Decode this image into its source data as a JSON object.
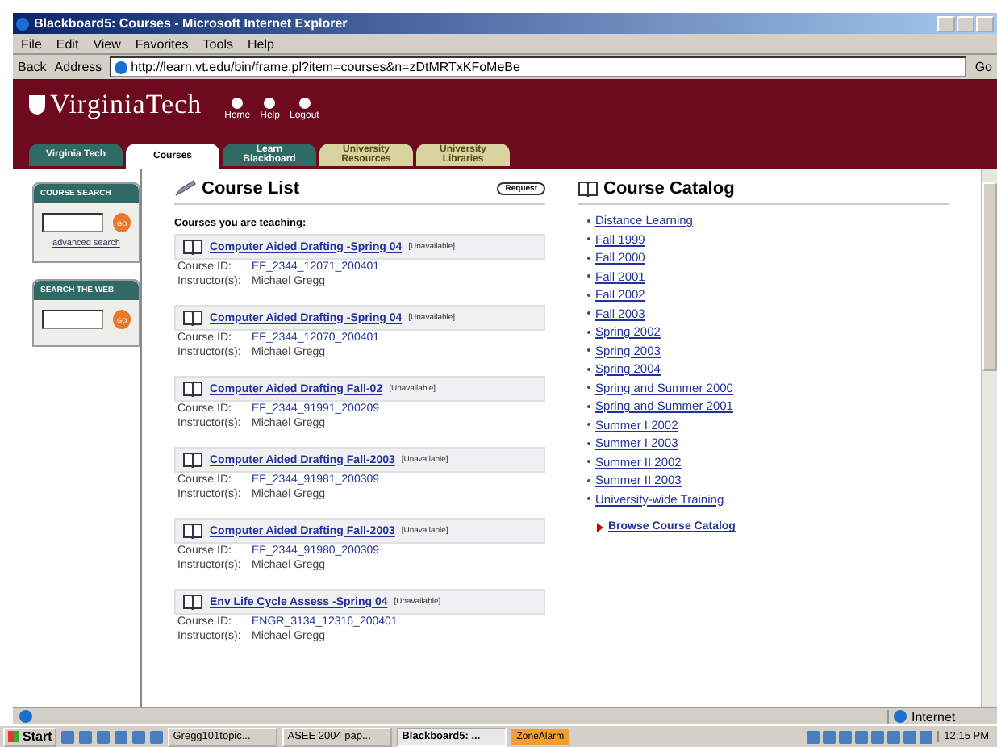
{
  "window": {
    "title": "Blackboard5: Courses - Microsoft Internet Explorer"
  },
  "menu": [
    "File",
    "Edit",
    "View",
    "Favorites",
    "Tools",
    "Help"
  ],
  "toolbar": {
    "back": "Back",
    "address_label": "Address",
    "url": "http://learn.vt.edu/bin/frame.pl?item=courses&n=zDtMRTxKFoMeBe",
    "go": "Go"
  },
  "header": {
    "logo": "VirginiaTech",
    "nav": [
      "Home",
      "Help",
      "Logout"
    ]
  },
  "tabs": [
    {
      "label": "Virginia Tech",
      "selected": false,
      "color": "#2f6b64"
    },
    {
      "label": "Courses",
      "selected": true,
      "color": "#ffffff"
    },
    {
      "label": "Learn Blackboard",
      "selected": false,
      "color": "#2f6b64"
    },
    {
      "label": "University Resources",
      "selected": false,
      "color": "#d8d3a0"
    },
    {
      "label": "University Libraries",
      "selected": false,
      "color": "#d8d3a0"
    }
  ],
  "sidebar": [
    {
      "title": "COURSE SEARCH",
      "button": "GO",
      "link": "advanced search"
    },
    {
      "title": "SEARCH THE WEB",
      "button": "GO"
    }
  ],
  "course_list": {
    "title": "Course List",
    "request": "Request",
    "subtitle": "Courses you are teaching:",
    "courses": [
      {
        "title": "Computer Aided Drafting -Spring 04",
        "status": "[Unavailable]",
        "id_label": "Course ID:",
        "id": "EF_2344_12071_200401",
        "instructor_label": "Instructor(s):",
        "instructor": "Michael Gregg"
      },
      {
        "title": "Computer Aided Drafting -Spring 04",
        "status": "[Unavailable]",
        "id_label": "Course ID:",
        "id": "EF_2344_12070_200401",
        "instructor_label": "Instructor(s):",
        "instructor": "Michael Gregg"
      },
      {
        "title": "Computer Aided Drafting Fall-02",
        "status": "[Unavailable]",
        "id_label": "Course ID:",
        "id": "EF_2344_91991_200209",
        "instructor_label": "Instructor(s):",
        "instructor": "Michael Gregg"
      },
      {
        "title": "Computer Aided Drafting Fall-2003",
        "status": "[Unavailable]",
        "id_label": "Course ID:",
        "id": "EF_2344_91981_200309",
        "instructor_label": "Instructor(s):",
        "instructor": "Michael Gregg"
      },
      {
        "title": "Computer Aided Drafting Fall-2003",
        "status": "[Unavailable]",
        "id_label": "Course ID:",
        "id": "EF_2344_91980_200309",
        "instructor_label": "Instructor(s):",
        "instructor": "Michael Gregg"
      },
      {
        "title": "Env Life Cycle Assess -Spring 04",
        "status": "[Unavailable]",
        "id_label": "Course ID:",
        "id": "ENGR_3134_12316_200401",
        "instructor_label": "Instructor(s):",
        "instructor": "Michael Gregg"
      }
    ]
  },
  "catalog": {
    "title": "Course Catalog",
    "items": [
      "Distance Learning",
      "Fall 1999",
      "Fall 2000",
      "Fall 2001",
      "Fall 2002",
      "Fall 2003",
      "Spring 2002",
      "Spring 2003",
      "Spring 2004",
      "Spring and Summer 2000",
      "Spring and Summer 2001",
      "Summer I 2002",
      "Summer I 2003",
      "Summer II 2002",
      "Summer II 2003",
      "University-wide Training"
    ],
    "browse": "Browse Course Catalog"
  },
  "status_bar": {
    "zone": "Internet"
  },
  "taskbar": {
    "start": "Start",
    "tasks": [
      {
        "label": "Gregg101topic...",
        "selected": false
      },
      {
        "label": "ASEE 2004 pap...",
        "selected": false
      },
      {
        "label": "Blackboard5: ...",
        "selected": true
      }
    ],
    "tray_label": "ZoneAlarm",
    "clock": "12:15 PM"
  }
}
